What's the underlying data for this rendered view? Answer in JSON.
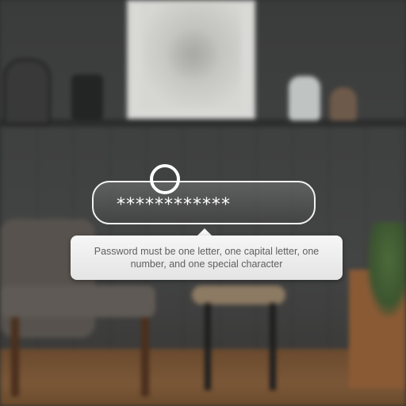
{
  "password_field": {
    "value": "************",
    "cursor_icon": "circle-cursor-icon"
  },
  "tooltip": {
    "message": "Password must be one letter, one capital letter, one number, and one special character"
  },
  "colors": {
    "field_border": "#f2f2f2",
    "tooltip_background": "#f2f2f2",
    "tooltip_text": "#5f5f5f"
  }
}
